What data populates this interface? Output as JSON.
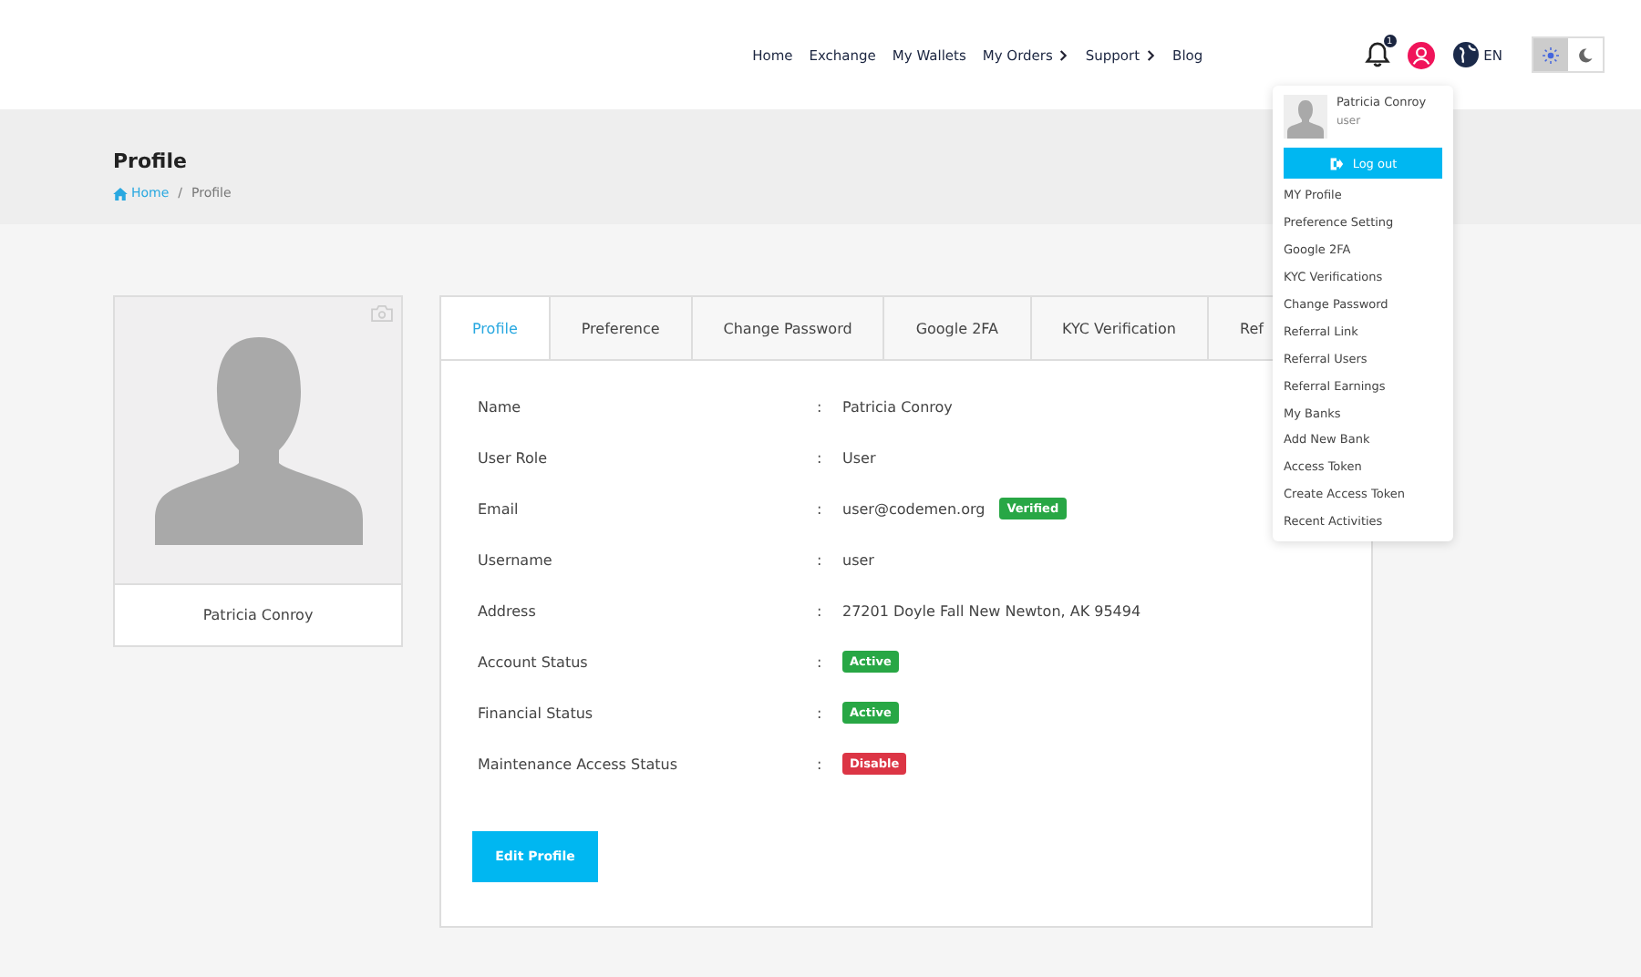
{
  "nav": [
    {
      "label": "Home",
      "has_submenu": false
    },
    {
      "label": "Exchange",
      "has_submenu": false
    },
    {
      "label": "My Wallets",
      "has_submenu": false
    },
    {
      "label": "My Orders",
      "has_submenu": true
    },
    {
      "label": "Support",
      "has_submenu": true
    },
    {
      "label": "Blog",
      "has_submenu": false
    }
  ],
  "notifications": {
    "count": "1"
  },
  "language": "EN",
  "theme_toggle": [
    {
      "kind": "sun",
      "selected": true
    },
    {
      "kind": "moon",
      "selected": false
    }
  ],
  "page_title": "Profile",
  "breadcrumb_separator": "/",
  "breadcrumb": [
    {
      "label": "Home",
      "kind": "link"
    },
    {
      "label": "Profile",
      "kind": "current"
    }
  ],
  "profile_card": {
    "name": "Patricia Conroy"
  },
  "tabs": [
    {
      "label": "Profile",
      "selected": true
    },
    {
      "label": "Preference",
      "selected": false
    },
    {
      "label": "Change Password",
      "selected": false
    },
    {
      "label": "Google 2FA",
      "selected": false
    },
    {
      "label": "KYC Verification",
      "selected": false
    },
    {
      "label": "Ref",
      "selected": false
    }
  ],
  "fields": [
    {
      "label": "Name",
      "value": "Patricia Conroy"
    },
    {
      "label": "User Role",
      "value": "User"
    },
    {
      "label": "Email",
      "value": "user@codemen.org",
      "badge": {
        "text": "Verified",
        "color": "#28a745"
      }
    },
    {
      "label": "Username",
      "value": "user"
    },
    {
      "label": "Address",
      "value": "27201 Doyle Fall New Newton, AK 95494"
    },
    {
      "label": "Account Status",
      "badge": {
        "text": "Active",
        "color": "#28a745"
      }
    },
    {
      "label": "Financial Status",
      "badge": {
        "text": "Active",
        "color": "#28a745"
      }
    },
    {
      "label": "Maintenance Access Status",
      "badge": {
        "text": "Disable",
        "color": "#dc3545"
      }
    }
  ],
  "separator": ":",
  "edit_button": "Edit Profile",
  "user_menu": {
    "name": "Patricia Conroy",
    "role": "user",
    "logout": "Log out",
    "items": [
      "MY Profile",
      "Preference Setting",
      "Google 2FA",
      "KYC Verifications",
      "Change Password",
      "Referral Link",
      "Referral Users",
      "Referral Earnings",
      "My Banks",
      "Add New Bank",
      "Access Token",
      "Create Access Token",
      "Recent Activities"
    ]
  }
}
